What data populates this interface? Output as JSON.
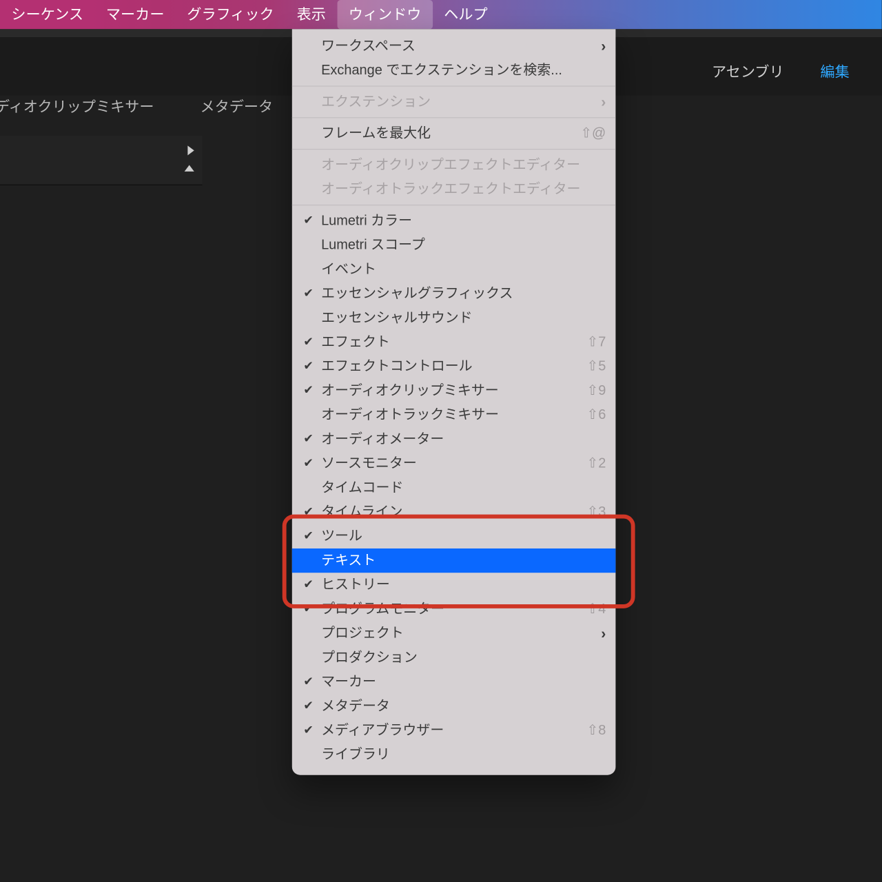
{
  "menubar": {
    "items": [
      "シーケンス",
      "マーカー",
      "グラフィック",
      "表示",
      "ウィンドウ",
      "ヘルプ"
    ],
    "openIndex": 4
  },
  "panelTabs": {
    "t0": "ーディオクリップミキサー",
    "t1": "メタデータ"
  },
  "wsRight": {
    "assembly": "アセンブリ",
    "edit": "編集"
  },
  "menu": {
    "workspace": "ワークスペース",
    "searchExt": "Exchange でエクステンションを検索...",
    "extensions": "エクステンション",
    "maxFrame": "フレームを最大化",
    "maxFrameKey": "⇧@",
    "audioClipEffect": "オーディオクリップエフェクトエディター",
    "audioTrackEffect": "オーディオトラックエフェクトエディター",
    "lumetriColor": "Lumetri カラー",
    "lumetriScope": "Lumetri スコープ",
    "events": "イベント",
    "essentialGraphics": "エッセンシャルグラフィックス",
    "essentialSound": "エッセンシャルサウンド",
    "effects": "エフェクト",
    "effectsKey": "⇧7",
    "effectControls": "エフェクトコントロール",
    "effectControlsKey": "⇧5",
    "audioClipMixer": "オーディオクリップミキサー",
    "audioClipMixerKey": "⇧9",
    "audioTrackMixer": "オーディオトラックミキサー",
    "audioTrackMixerKey": "⇧6",
    "audioMeter": "オーディオメーター",
    "sourceMonitor": "ソースモニター",
    "sourceMonitorKey": "⇧2",
    "timecode": "タイムコード",
    "timeline": "タイムライン",
    "timelineKey": "⇧3",
    "tools": "ツール",
    "text": "テキスト",
    "history": "ヒストリー",
    "programMonitor": "プログラムモニター",
    "programMonitorKey": "⇧4",
    "project": "プロジェクト",
    "production": "プロダクション",
    "markers": "マーカー",
    "metadata": "メタデータ",
    "mediaBrowser": "メディアブラウザー",
    "mediaBrowserKey": "⇧8",
    "library": "ライブラリ"
  }
}
